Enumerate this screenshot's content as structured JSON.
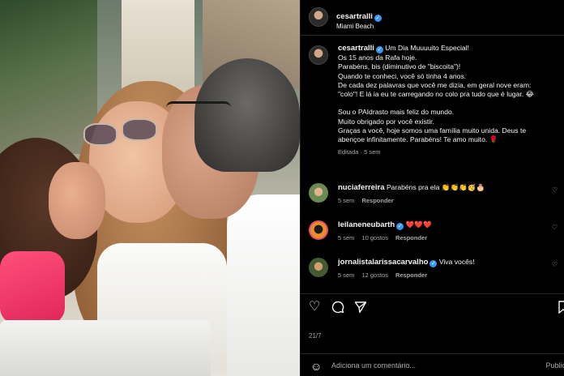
{
  "post": {
    "author": "cesartralli",
    "location": "Miami Beach",
    "caption_lines": [
      "Um Dia Muuuuito Especial!",
      "Os 15 anos da Rafa hoje.",
      "Parabéns, bis (diminutivo de \"biscoita\")!",
      "Quando te conheci, você só tinha 4 anos.",
      "De cada dez palavras que você me dizia, em geral nove eram:",
      "\"colo\"! E lá ia eu te carregando no colo pra tudo que é lugar. 😂"
    ],
    "caption_lines_2": [
      "Sou o PAIdrasto mais feliz do mundo.",
      "Muito obrigado por você existir.",
      "Graças a você, hoje somos uma família muito unida. Deus te",
      "abençoe infinitamente. Parabéns! Te amo muito. 🌹"
    ],
    "edited": "Editada · 5 sem"
  },
  "comments": [
    {
      "user": "nuciaferreira",
      "verified": false,
      "text": "Parabéns pra ela 👏👏👏🥳🎂",
      "time": "5 sem",
      "likes": "",
      "reply": "Responder"
    },
    {
      "user": "leilaneneubarth",
      "verified": true,
      "text": "❤️❤️❤️",
      "time": "5 sem",
      "likes": "10 gostos",
      "reply": "Responder"
    },
    {
      "user": "jornalistalarissacarvalho",
      "verified": true,
      "text": "Viva vocês!",
      "time": "5 sem",
      "likes": "12 gostos",
      "reply": "Responder"
    }
  ],
  "likes_text": "21/7",
  "add_comment": {
    "placeholder": "Adiciona um comentário...",
    "post_label": "Publicar"
  },
  "icons": {
    "like": "heart-icon",
    "comment": "comment-icon",
    "share": "share-icon",
    "verified": "verified-badge-icon",
    "emoji": "emoji-icon",
    "more": "more-icon"
  },
  "colors": {
    "verified": "#3897f0",
    "heart": "#ed4956",
    "panel_bg": "#000000"
  }
}
